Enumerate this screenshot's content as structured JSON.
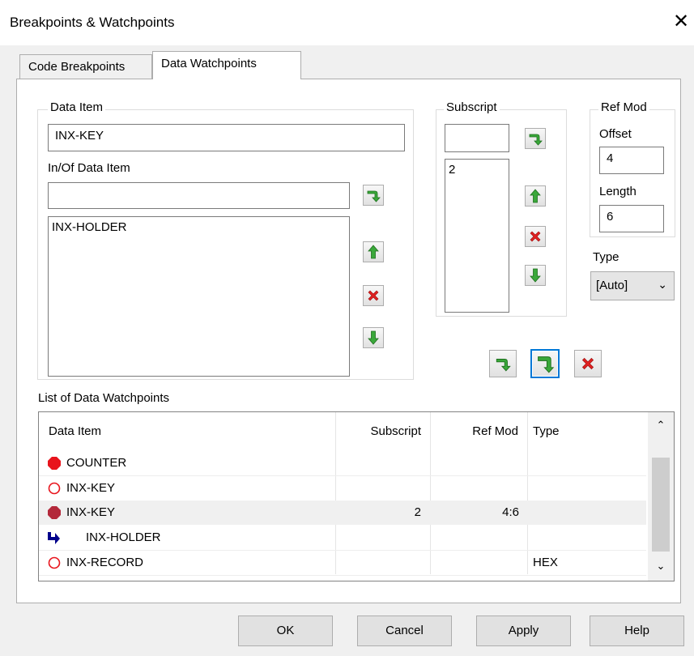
{
  "window": {
    "title": "Breakpoints & Watchpoints"
  },
  "tabs": [
    {
      "label": "Code Breakpoints",
      "active": false
    },
    {
      "label": "Data Watchpoints",
      "active": true
    }
  ],
  "data_item": {
    "group_label": "Data Item",
    "value": "INX-KEY",
    "in_of_label": "In/Of Data Item",
    "in_of_value": "",
    "list": [
      "INX-HOLDER"
    ]
  },
  "subscript": {
    "group_label": "Subscript",
    "value": "",
    "list": [
      "2"
    ]
  },
  "refmod": {
    "group_label": "Ref Mod",
    "offset_label": "Offset",
    "offset_value": "4",
    "length_label": "Length",
    "length_value": "6"
  },
  "type": {
    "label": "Type",
    "selected": "[Auto]"
  },
  "watchlist": {
    "label": "List of Data Watchpoints",
    "columns": [
      "Data Item",
      "Subscript",
      "Ref Mod",
      "Type"
    ],
    "rows": [
      {
        "icon": "filled-stop-icon",
        "item": "COUNTER",
        "subscript": "",
        "refmod": "",
        "type": ""
      },
      {
        "icon": "hollow-circle-icon",
        "item": "INX-KEY",
        "subscript": "",
        "refmod": "",
        "type": ""
      },
      {
        "icon": "filled-stop-dark-icon",
        "item": "INX-KEY",
        "subscript": "2",
        "refmod": "4:6",
        "type": ""
      },
      {
        "icon": "blue-arrow-icon",
        "item": "INX-HOLDER",
        "subscript": "",
        "refmod": "",
        "type": ""
      },
      {
        "icon": "hollow-circle-icon",
        "item": "INX-RECORD",
        "subscript": "",
        "refmod": "",
        "type": "HEX"
      }
    ]
  },
  "buttons": {
    "ok": "OK",
    "cancel": "Cancel",
    "apply": "Apply",
    "help": "Help"
  },
  "colors": {
    "stop_red": "#e8141c",
    "stop_dark": "#b3283a",
    "arrow_blue": "#00008b",
    "add_green": "#37a037",
    "delete_red": "#e02020",
    "focus_blue": "#0078d7"
  }
}
